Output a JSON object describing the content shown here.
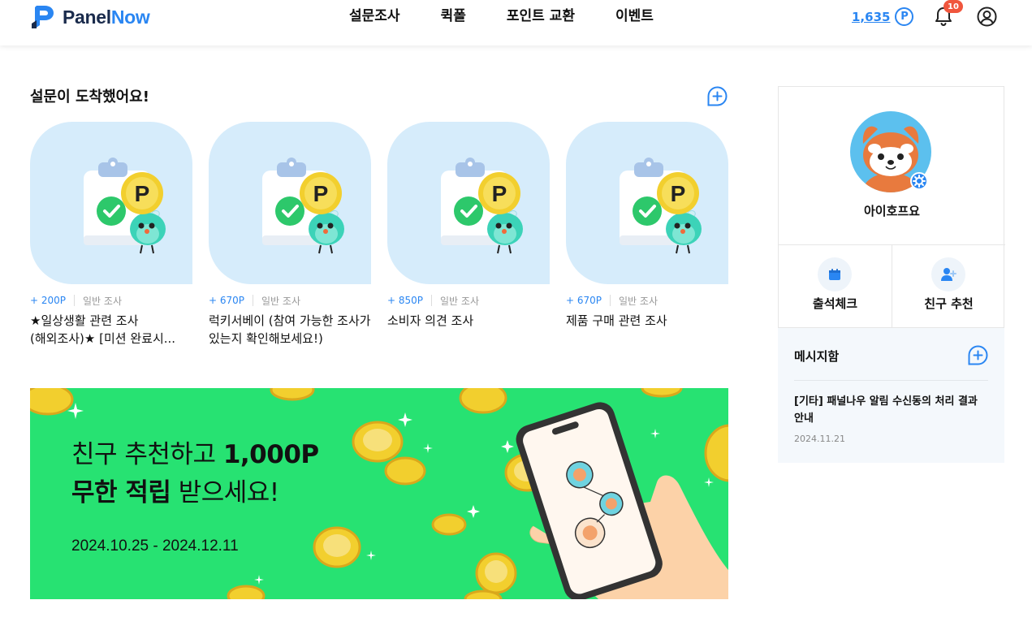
{
  "header": {
    "logo_prefix": "Panel",
    "logo_suffix": "Now",
    "nav": [
      "설문조사",
      "퀵폴",
      "포인트 교환",
      "이벤트"
    ],
    "points": "1,635",
    "points_symbol": "P",
    "notification_count": "10"
  },
  "surveys": {
    "title": "설문이 도착했어요!",
    "items": [
      {
        "points": "+ 200P",
        "type": "일반 조사",
        "title": "★일상생활 관련 조사(해외조사)★ [미션 완료시..."
      },
      {
        "points": "+ 670P",
        "type": "일반 조사",
        "title": "럭키서베이 (참여 가능한 조사가 있는지 확인해보세요!)"
      },
      {
        "points": "+ 850P",
        "type": "일반 조사",
        "title": "소비자 의견 조사"
      },
      {
        "points": "+ 670P",
        "type": "일반 조사",
        "title": "제품 구매 관련 조사"
      }
    ],
    "card_badge": "P"
  },
  "banner": {
    "line1_text": "친구 추천하고 ",
    "line1_bold": "1,000P",
    "line2_bold": "무한 적립",
    "line2_text": " 받으세요!",
    "date": "2024.10.25 - 2024.12.11",
    "colors": {
      "background": "#27e272",
      "coin": "#f2cf2e"
    }
  },
  "profile": {
    "nickname": "아이호프요",
    "actions": [
      "출석체크",
      "친구 추천"
    ]
  },
  "messages": {
    "title": "메시지함",
    "items": [
      {
        "text": "[기타] 패널나우 알림 수신동의 처리 결과 안내",
        "date": "2024.11.21"
      }
    ]
  },
  "colors": {
    "accent": "#2a86f2",
    "badge": "#f0563d"
  }
}
